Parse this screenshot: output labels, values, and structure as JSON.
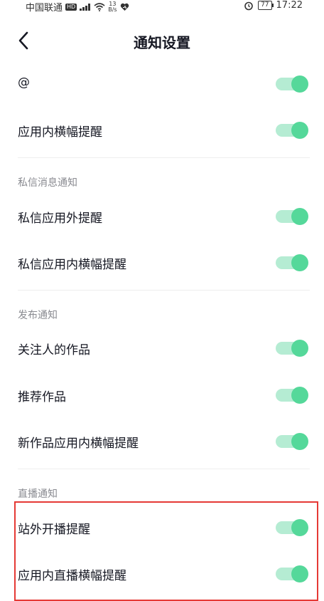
{
  "status_bar": {
    "carrier": "中国联通",
    "hd": "HD",
    "net_speed_value": "13",
    "net_speed_unit": "B/s",
    "battery": "77",
    "time": "17:22"
  },
  "nav": {
    "title": "通知设置"
  },
  "rows": {
    "mention": {
      "label": "@",
      "enabled": true
    },
    "in_app_banner": {
      "label": "应用内横幅提醒",
      "enabled": true
    },
    "dm_outside": {
      "label": "私信应用外提醒",
      "enabled": true
    },
    "dm_in_app_banner": {
      "label": "私信应用内横幅提醒",
      "enabled": true
    },
    "followed_works": {
      "label": "关注人的作品",
      "enabled": true
    },
    "recommended_works": {
      "label": "推荐作品",
      "enabled": true
    },
    "new_works_banner": {
      "label": "新作品应用内横幅提醒",
      "enabled": true
    },
    "live_outside": {
      "label": "站外开播提醒",
      "enabled": true
    },
    "live_in_app_banner": {
      "label": "应用内直播横幅提醒",
      "enabled": true
    }
  },
  "sections": {
    "dm": "私信消息通知",
    "publish": "发布通知",
    "live": "直播通知"
  },
  "colors": {
    "toggle_knob": "#55d89a",
    "toggle_track": "#b5ecd3",
    "highlight": "#e53935"
  }
}
